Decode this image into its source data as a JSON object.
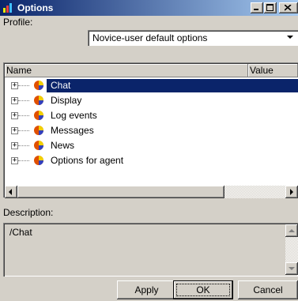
{
  "window": {
    "title": "Options"
  },
  "profile": {
    "label": "Profile:",
    "value": "Novice-user default options"
  },
  "tree": {
    "columns": {
      "name": "Name",
      "value": "Value"
    },
    "items": [
      {
        "label": "Chat",
        "selected": true
      },
      {
        "label": "Display",
        "selected": false
      },
      {
        "label": "Log events",
        "selected": false
      },
      {
        "label": "Messages",
        "selected": false
      },
      {
        "label": "News",
        "selected": false
      },
      {
        "label": "Options for agent",
        "selected": false
      }
    ],
    "expander_symbol": "+"
  },
  "description": {
    "label": "Description:",
    "text": "/Chat"
  },
  "buttons": {
    "apply": "Apply",
    "ok": "OK",
    "cancel": "Cancel"
  },
  "colors": {
    "titlebar_start": "#0a246a",
    "titlebar_end": "#a6caf0",
    "selection": "#0a246a",
    "face": "#d4d0c8"
  },
  "icons": {
    "app": "options-app-icon",
    "item": "option-category-icon"
  }
}
